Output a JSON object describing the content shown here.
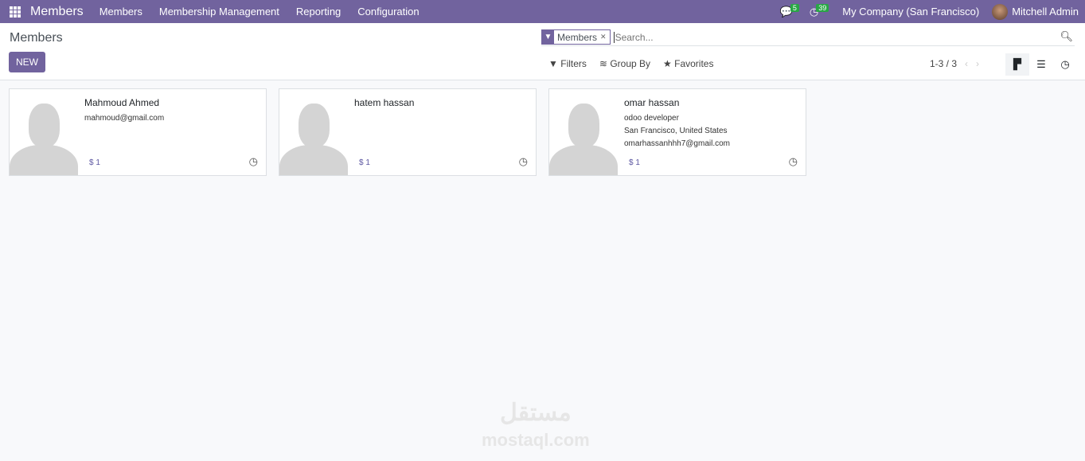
{
  "nav": {
    "brand": "Members",
    "menus": [
      "Members",
      "Membership Management",
      "Reporting",
      "Configuration"
    ],
    "messages_count": "5",
    "activities_count": "39",
    "company": "My Company (San Francisco)",
    "user": "Mitchell Admin"
  },
  "control": {
    "title": "Members",
    "new_label": "NEW",
    "facet": "Members",
    "search_placeholder": "Search...",
    "filters": "Filters",
    "group_by": "Group By",
    "favorites": "Favorites",
    "pager": "1-3 / 3"
  },
  "cards": [
    {
      "name": "Mahmoud Ahmed",
      "lines": [
        "mahmoud@gmail.com"
      ],
      "amount": "$ 1"
    },
    {
      "name": "hatem hassan",
      "lines": [],
      "amount": "$ 1"
    },
    {
      "name": "omar hassan",
      "lines": [
        "odoo developer",
        "San Francisco, United States",
        "omarhassanhhh7@gmail.com"
      ],
      "amount": "$ 1"
    }
  ],
  "watermark": {
    "arabic": "مستقل",
    "latin": "mostaql.com"
  }
}
